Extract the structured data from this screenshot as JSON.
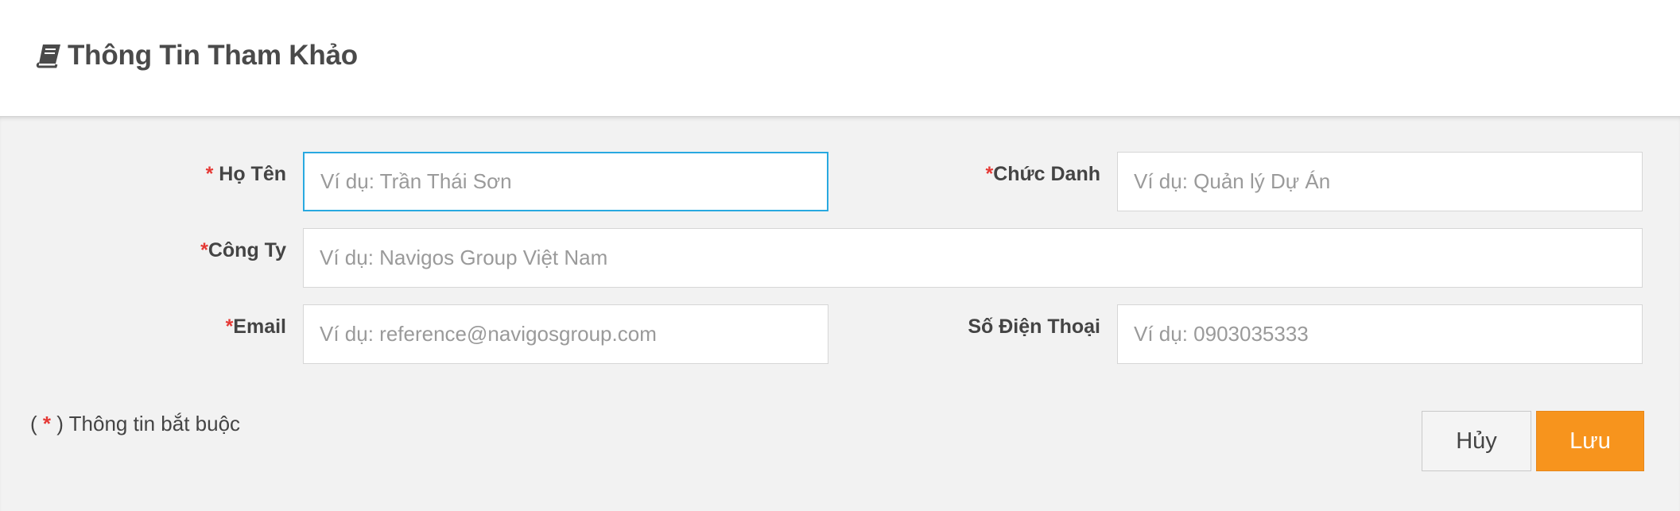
{
  "header": {
    "icon": "book-icon",
    "title": "Thông Tin Tham Khảo"
  },
  "form": {
    "full_name": {
      "required_mark": "*",
      "label": " Họ Tên",
      "placeholder": "Ví dụ: Trần Thái Sơn",
      "value": ""
    },
    "job_title": {
      "required_mark": "*",
      "label": "Chức Danh",
      "placeholder": "Ví dụ: Quản lý Dự Án",
      "value": ""
    },
    "company": {
      "required_mark": "*",
      "label": "Công Ty",
      "placeholder": "Ví dụ: Navigos Group Việt Nam",
      "value": ""
    },
    "email": {
      "required_mark": "*",
      "label": "Email",
      "placeholder": "Ví dụ: reference@navigosgroup.com",
      "value": ""
    },
    "phone": {
      "label": "Số Điện Thoại",
      "placeholder": "Ví dụ: 0903035333",
      "value": ""
    }
  },
  "note": {
    "open": "( ",
    "mark": "*",
    "close": " ) Thông tin bắt buộc"
  },
  "actions": {
    "cancel_label": "Hủy",
    "save_label": "Lưu"
  },
  "colors": {
    "accent_orange": "#f7941d",
    "focus_blue": "#29a9e0",
    "required_red": "#e53935",
    "panel_bg": "#f2f2f2"
  }
}
